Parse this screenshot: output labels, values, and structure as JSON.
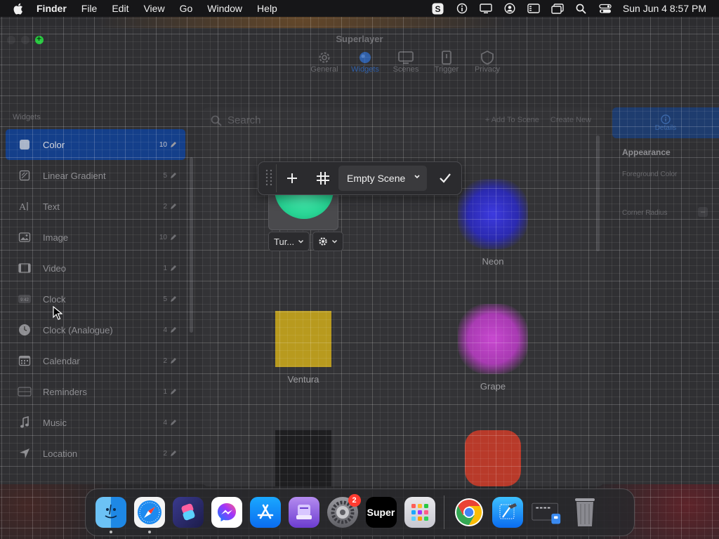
{
  "menubar": {
    "app_name": "Finder",
    "items": [
      "File",
      "Edit",
      "View",
      "Go",
      "Window",
      "Help"
    ],
    "clock": "Sun Jun 4  8:57 PM"
  },
  "window": {
    "title": "Superlayer",
    "toolbar": [
      {
        "label": "General",
        "icon": "gear-icon"
      },
      {
        "label": "Widgets",
        "icon": "widgets-icon",
        "active": true
      },
      {
        "label": "Scenes",
        "icon": "scenes-icon"
      },
      {
        "label": "Trigger",
        "icon": "trigger-icon"
      },
      {
        "label": "Privacy",
        "icon": "privacy-icon"
      }
    ]
  },
  "sidebar": {
    "header": "Widgets",
    "items": [
      {
        "label": "Color",
        "count": "10",
        "icon": "color-icon",
        "selected": true
      },
      {
        "label": "Linear Gradient",
        "count": "5",
        "icon": "gradient-icon"
      },
      {
        "label": "Text",
        "count": "2",
        "icon": "text-icon"
      },
      {
        "label": "Image",
        "count": "10",
        "icon": "image-icon"
      },
      {
        "label": "Video",
        "count": "1",
        "icon": "video-icon"
      },
      {
        "label": "Clock",
        "count": "5",
        "icon": "clock-digital-icon"
      },
      {
        "label": "Clock (Analogue)",
        "count": "4",
        "icon": "clock-analogue-icon"
      },
      {
        "label": "Calendar",
        "count": "2",
        "icon": "calendar-icon"
      },
      {
        "label": "Reminders",
        "count": "1",
        "icon": "reminders-icon"
      },
      {
        "label": "Music",
        "count": "4",
        "icon": "music-icon"
      },
      {
        "label": "Location",
        "count": "2",
        "icon": "location-icon"
      }
    ]
  },
  "content": {
    "search_placeholder": "Search",
    "add_to_scene": "+ Add To Scene",
    "create_new": "Create New",
    "widgets": [
      {
        "label": "Neon",
        "color": "#3a3ad8"
      },
      {
        "label": "Ventura",
        "color": "#b89a1e"
      },
      {
        "label": "Grape",
        "color": "#c040c8"
      },
      {
        "label": "",
        "color": "#1e1e20"
      },
      {
        "label": "",
        "color": "#c0392b"
      }
    ]
  },
  "inspector": {
    "tab_label": "Details",
    "heading": "Appearance",
    "foreground_color": "Foreground Color",
    "corner_radius": "Corner Radius",
    "minus": "–"
  },
  "float_toolbar": {
    "scene_select": "Empty Scene"
  },
  "edit_controls": {
    "widget_select": "Tur...",
    "editing_color": "#3ce8a8"
  },
  "dock": {
    "apps": [
      "Finder",
      "Safari",
      "Shortcuts",
      "Messenger",
      "App Store",
      "Apple Configurator",
      "System Settings",
      "Super",
      "Launchpad",
      "Chrome",
      "Xcode",
      "Screen Sharing",
      "Trash"
    ],
    "settings_badge": "2",
    "super_label": "Super"
  }
}
